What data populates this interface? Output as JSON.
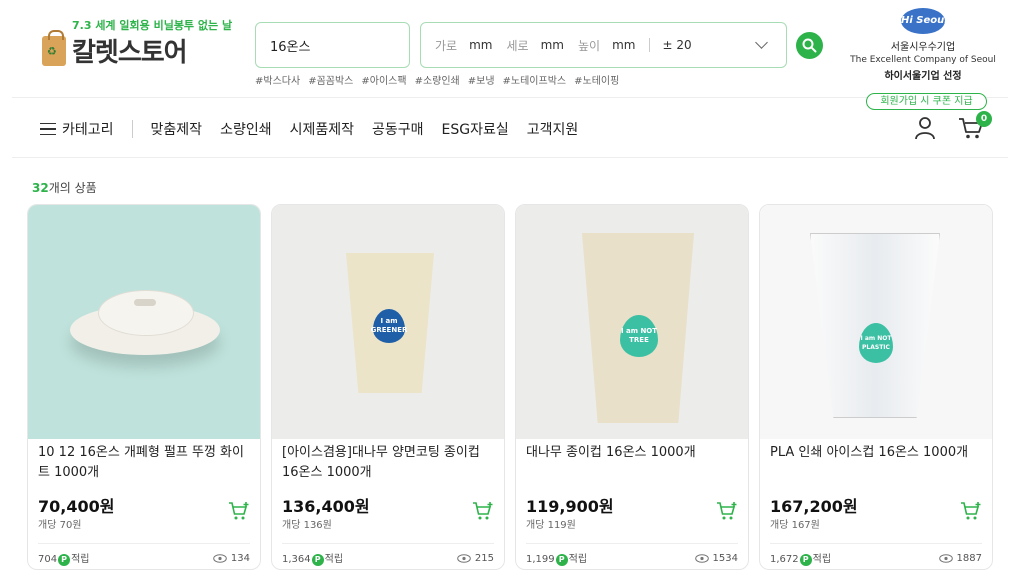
{
  "header": {
    "slogan": "7.3 세계 일회용 비닐봉투 없는 날",
    "logo_text": "칼렛스토어",
    "search_value": "16온스",
    "dims": {
      "w_label": "가로",
      "h_label": "세로",
      "d_label": "높이",
      "unit": "mm",
      "tolerance": "± 20"
    },
    "tags": [
      "#박스다사",
      "#꼼꼼박스",
      "#아이스팩",
      "#소량인쇄",
      "#보냉",
      "#노테이프박스",
      "#노테이핑"
    ],
    "seoul": {
      "logo": "Hi Seoul",
      "line1": "서울시우수기업",
      "line2": "The Excellent Company of Seoul",
      "line3": "하이서울기업 선정"
    },
    "coupon": "회원가입 시 쿠폰 지급",
    "cart_count": "0"
  },
  "nav": {
    "category": "카테고리",
    "items": [
      "맞춤제작",
      "소량인쇄",
      "시제품제작",
      "공동구매",
      "ESG자료실",
      "고객지원"
    ]
  },
  "listing": {
    "count": "32",
    "count_suffix": "개의 상품"
  },
  "products": [
    {
      "title": "10 12 16온스 개폐형 펄프 뚜껑 화이트 1000개",
      "price": "70,400원",
      "unit": "개당 70원",
      "points": "704",
      "points_label": "적립",
      "views": "134"
    },
    {
      "title": "[아이스겸용]대나무 양면코팅 종이컵 16온스 1000개",
      "price": "136,400원",
      "unit": "개당 136원",
      "points": "1,364",
      "points_label": "적립",
      "views": "215",
      "drop_text": "I am GREENER"
    },
    {
      "title": "대나무 종이컵 16온스 1000개",
      "price": "119,900원",
      "unit": "개당 119원",
      "points": "1,199",
      "points_label": "적립",
      "views": "1534",
      "drop_text": "I am NOT TREE"
    },
    {
      "title": "PLA 인쇄 아이스컵 16온스 1000개",
      "price": "167,200원",
      "unit": "개당 167원",
      "points": "1,672",
      "points_label": "적립",
      "views": "1887",
      "drop_text": "I am NOT PLASTIC"
    }
  ],
  "colors": {
    "accent": "#2db34a",
    "drop_blue": "#1f5fa8",
    "drop_teal": "#3cc0a4"
  }
}
